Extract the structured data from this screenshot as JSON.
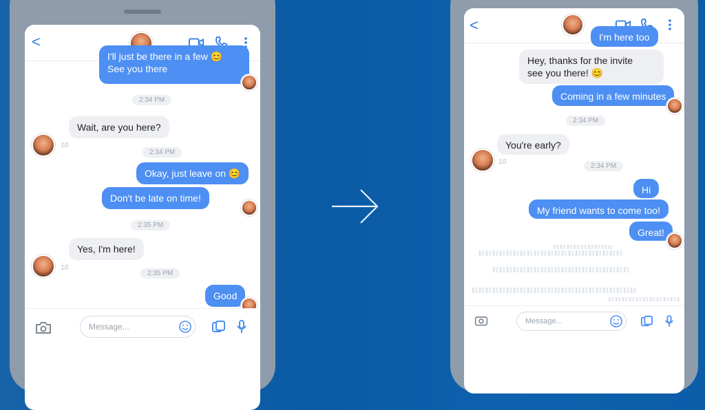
{
  "left_phone": {
    "header": {
      "back": "<"
    },
    "messages": [
      {
        "text": "I'll just be there in a few 😊 See you there",
        "line1": "I'll just be there in a few 😊",
        "line2": "See you there"
      },
      {
        "text": "Wait, are you here?"
      },
      {
        "text": "Okay, just leave on 😊"
      },
      {
        "text": "Don't be late on time!"
      },
      {
        "text": "Yes, I'm here!"
      },
      {
        "text": "Good"
      }
    ],
    "timestamps": [
      "2:34 PM",
      "2:34 PM",
      "2:35 PM",
      "2:35 PM"
    ],
    "read_marks": [
      "10",
      "10"
    ],
    "composer": {
      "placeholder": "Message..."
    }
  },
  "right_phone": {
    "header": {
      "back": "<"
    },
    "messages": [
      {
        "text": "I'm here too"
      },
      {
        "text": "Hey, thanks for the invite, see you there! 😊",
        "line1": "Hey, thanks for the invite",
        "line2": "see you there! 😊"
      },
      {
        "text": "Coming in a few minutes"
      },
      {
        "text": "You're early?"
      },
      {
        "text": "Hi"
      },
      {
        "text": "My friend wants to come too!"
      },
      {
        "text": "Great!"
      }
    ],
    "timestamps": [
      "2:34 PM",
      "2:34 PM"
    ],
    "read_marks": [
      "10"
    ],
    "composer": {
      "placeholder": "Message..."
    }
  },
  "colors": {
    "outgoing": "#4d8ff2",
    "incoming": "#eeeff2",
    "accent": "#2f7de1",
    "background": "#0a5aa5"
  },
  "icons": [
    "back-icon",
    "video-icon",
    "phone-icon",
    "more-icon",
    "camera-icon",
    "emoji-icon",
    "gallery-icon",
    "mic-icon",
    "arrow-right-icon"
  ]
}
